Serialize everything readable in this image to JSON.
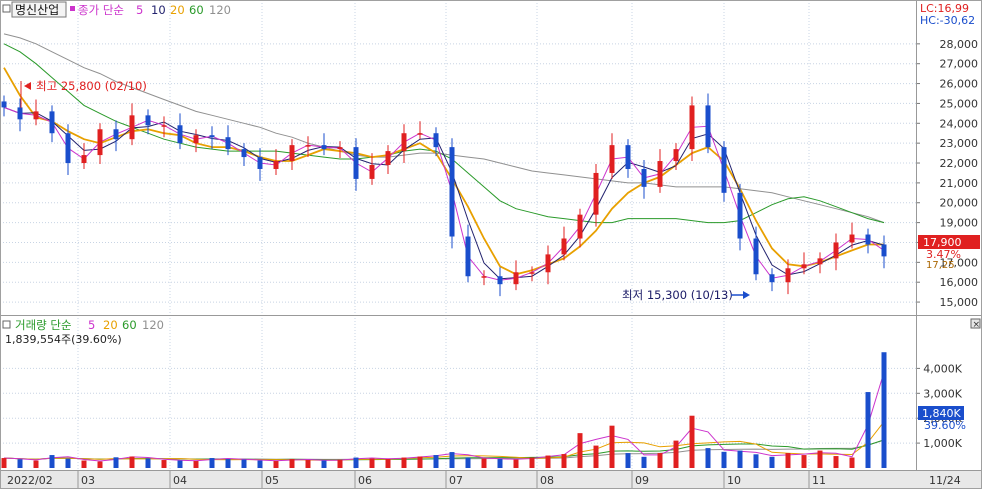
{
  "header": {
    "stock_name": "명신산업",
    "price_legend_label": "종가 단순",
    "ma_periods": [
      "5",
      "10",
      "20",
      "60",
      "120"
    ],
    "volume_legend_label": "거래량 단순",
    "volume_readout": "1,839,554주(39.60%)"
  },
  "readouts": {
    "lc": "LC:16,99",
    "hc": "HC:-30,62",
    "last_price_badge": "17,900",
    "last_change": "3.47%",
    "last_volume_badge": "1,840K",
    "last_volume_ratio": "39.60%",
    "last_close_marker": "17,25"
  },
  "annotations": {
    "high_label": "최고 25,800 (02/10)",
    "low_label": "최저 15,300 (10/13)"
  },
  "colors": {
    "up": "#e02020",
    "down": "#1a4ecc",
    "ma5": "#cc33cc",
    "ma10": "#22226e",
    "ma20": "#e8a000",
    "ma60": "#2a9a2a",
    "ma120": "#909090",
    "grid": "#c8d4e4",
    "axis_text": "#333333"
  },
  "chart_data": [
    {
      "type": "candlestick",
      "title": "",
      "y_ticks": [
        "15,000",
        "16,000",
        "17,000",
        "18,000",
        "19,000",
        "20,000",
        "21,000",
        "22,000",
        "23,000",
        "24,000",
        "25,000",
        "26,000",
        "27,000",
        "28,000"
      ],
      "ylim": [
        14500,
        29200
      ],
      "grid": true,
      "series": [
        {
          "name": "종가",
          "values": [
            24800,
            24200,
            24600,
            23500,
            22000,
            22400,
            23700,
            23200,
            24400,
            23900,
            23900,
            23000,
            23400,
            23300,
            22700,
            22300,
            21700,
            22100,
            22900,
            22900,
            22700,
            22800,
            21200,
            21900,
            22600,
            23500,
            23500,
            22800,
            18300,
            16300,
            16300,
            15900,
            16500,
            16500,
            17400,
            18200,
            19400,
            21500,
            22900,
            21700,
            20800,
            22100,
            22700,
            24900,
            22800,
            20500,
            18200,
            16400,
            16000,
            16700,
            16900,
            17200,
            18000,
            18400,
            17900,
            17300
          ]
        },
        {
          "name": "MA20",
          "values": [
            26800,
            25400,
            24300,
            24100,
            23600,
            23200,
            23000,
            23300,
            23600,
            23700,
            23500,
            23400,
            23000,
            22800,
            22800,
            22600,
            22300,
            22100,
            22100,
            22400,
            22700,
            22600,
            22500,
            22300,
            22400,
            22700,
            23000,
            22500,
            21200,
            19800,
            18200,
            16800,
            16400,
            16600,
            16900,
            17200,
            17800,
            18600,
            19700,
            20500,
            21000,
            21300,
            21900,
            22500,
            22800,
            22100,
            20700,
            19100,
            17700,
            16900,
            16800,
            17000,
            17300,
            17600,
            17900,
            17900
          ]
        },
        {
          "name": "MA60",
          "values": [
            28000,
            27600,
            27000,
            26300,
            25600,
            24900,
            24500,
            24100,
            23800,
            23500,
            23200,
            23000,
            22800,
            22700,
            22600,
            22600,
            22600,
            22600,
            22500,
            22400,
            22300,
            22200,
            22200,
            22300,
            22400,
            22600,
            22700,
            22600,
            22200,
            21500,
            20800,
            20100,
            19700,
            19500,
            19300,
            19200,
            19100,
            19000,
            19000,
            19200,
            19200,
            19200,
            19200,
            19100,
            19000,
            19000,
            19100,
            19500,
            19900,
            20200,
            20300,
            20100,
            19800,
            19500,
            19200,
            19000
          ]
        },
        {
          "name": "MA120",
          "values": [
            28500,
            28300,
            28000,
            27600,
            27200,
            26800,
            26500,
            26100,
            25800,
            25500,
            25200,
            24900,
            24600,
            24400,
            24200,
            24000,
            23800,
            23500,
            23300,
            23000,
            22800,
            22600,
            22400,
            22300,
            22300,
            22400,
            22500,
            22500,
            22400,
            22300,
            22200,
            22000,
            21800,
            21600,
            21500,
            21400,
            21300,
            21200,
            21100,
            21000,
            21000,
            20900,
            20800,
            20800,
            20800,
            20800,
            20700,
            20600,
            20500,
            20300,
            20100,
            19900,
            19700,
            19500,
            19300,
            19000
          ]
        }
      ]
    },
    {
      "type": "bar",
      "title": "",
      "y_ticks": [
        "1,000K",
        "2,000K",
        "3,000K",
        "4,000K"
      ],
      "ylim": [
        0,
        4900
      ],
      "x_tick_labels": [
        "2022/02",
        "03",
        "04",
        "05",
        "06",
        "07",
        "08",
        "09",
        "10",
        "11",
        "11/24"
      ],
      "series": [
        {
          "name": "거래량",
          "values": [
            400,
            350,
            300,
            520,
            380,
            300,
            260,
            430,
            460,
            380,
            320,
            300,
            280,
            400,
            360,
            340,
            300,
            280,
            360,
            320,
            300,
            330,
            420,
            380,
            360,
            420,
            460,
            520,
            640,
            420,
            380,
            360,
            340,
            420,
            500,
            560,
            1400,
            900,
            1700,
            600,
            450,
            600,
            1100,
            2100,
            800,
            650,
            700,
            550,
            450,
            600,
            520,
            700,
            480,
            420,
            3050,
            4650
          ]
        }
      ]
    }
  ]
}
